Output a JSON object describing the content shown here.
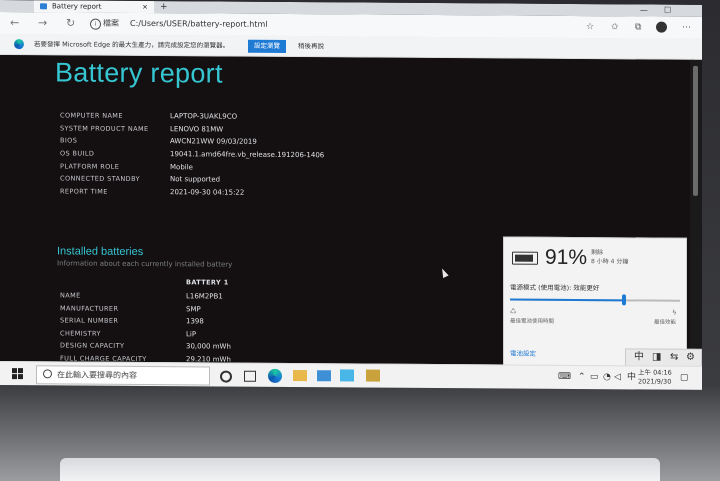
{
  "browser": {
    "tab_title": "Battery report",
    "tab_close": "×",
    "new_tab": "+",
    "window_controls": [
      "—",
      "☐"
    ],
    "address_label": "檔案",
    "address_url": "C:/Users/USER/battery-report.html",
    "infobar": {
      "message": "若要發揮 Microsoft Edge 的最大生產力，請完成設定您的瀏覽器。",
      "primary_button": "設定瀏覽",
      "secondary_button": "稍後再說"
    }
  },
  "report": {
    "title": "Battery report",
    "system_info": [
      {
        "key": "COMPUTER NAME",
        "value": "LAPTOP-3UAKL9CO"
      },
      {
        "key": "SYSTEM PRODUCT NAME",
        "value": "LENOVO 81MW"
      },
      {
        "key": "BIOS",
        "value": "AWCN21WW 09/03/2019"
      },
      {
        "key": "OS BUILD",
        "value": "19041.1.amd64fre.vb_release.191206-1406"
      },
      {
        "key": "PLATFORM ROLE",
        "value": "Mobile"
      },
      {
        "key": "CONNECTED STANDBY",
        "value": "Not supported"
      },
      {
        "key": "REPORT TIME",
        "value": "2021-09-30  04:15:22"
      }
    ],
    "installed_batteries": {
      "heading": "Installed batteries",
      "subtitle": "Information about each currently installed battery",
      "column_header": "BATTERY 1",
      "rows": [
        {
          "key": "NAME",
          "value": "L16M2PB1"
        },
        {
          "key": "MANUFACTURER",
          "value": "SMP"
        },
        {
          "key": "SERIAL NUMBER",
          "value": "1398"
        },
        {
          "key": "CHEMISTRY",
          "value": "LiP"
        },
        {
          "key": "DESIGN CAPACITY",
          "value": "30,000 mWh"
        },
        {
          "key": "FULL CHARGE CAPACITY",
          "value": "29,210 mWh"
        }
      ]
    }
  },
  "battery_flyout": {
    "percent": "91%",
    "remaining_label": "剩餘",
    "remaining_value": "8 小時 4 分鐘",
    "mode_label": "電源模式 (使用電池): 效能更好",
    "mode_level": 0.67,
    "mode_left_label": "最佳電池使用時間",
    "mode_right_label": "最佳效能",
    "settings_link": "電池設定"
  },
  "ime_bar": [
    "中",
    "◨",
    "⇆",
    "⚙"
  ],
  "taskbar": {
    "search_placeholder": "在此輸入要搜尋的內容",
    "time": "上午 04:16",
    "date": "2021/9/30"
  },
  "colors": {
    "accent": "#35c6d2",
    "page_bg": "#140f10",
    "edge_blue": "#1f7ad4"
  }
}
